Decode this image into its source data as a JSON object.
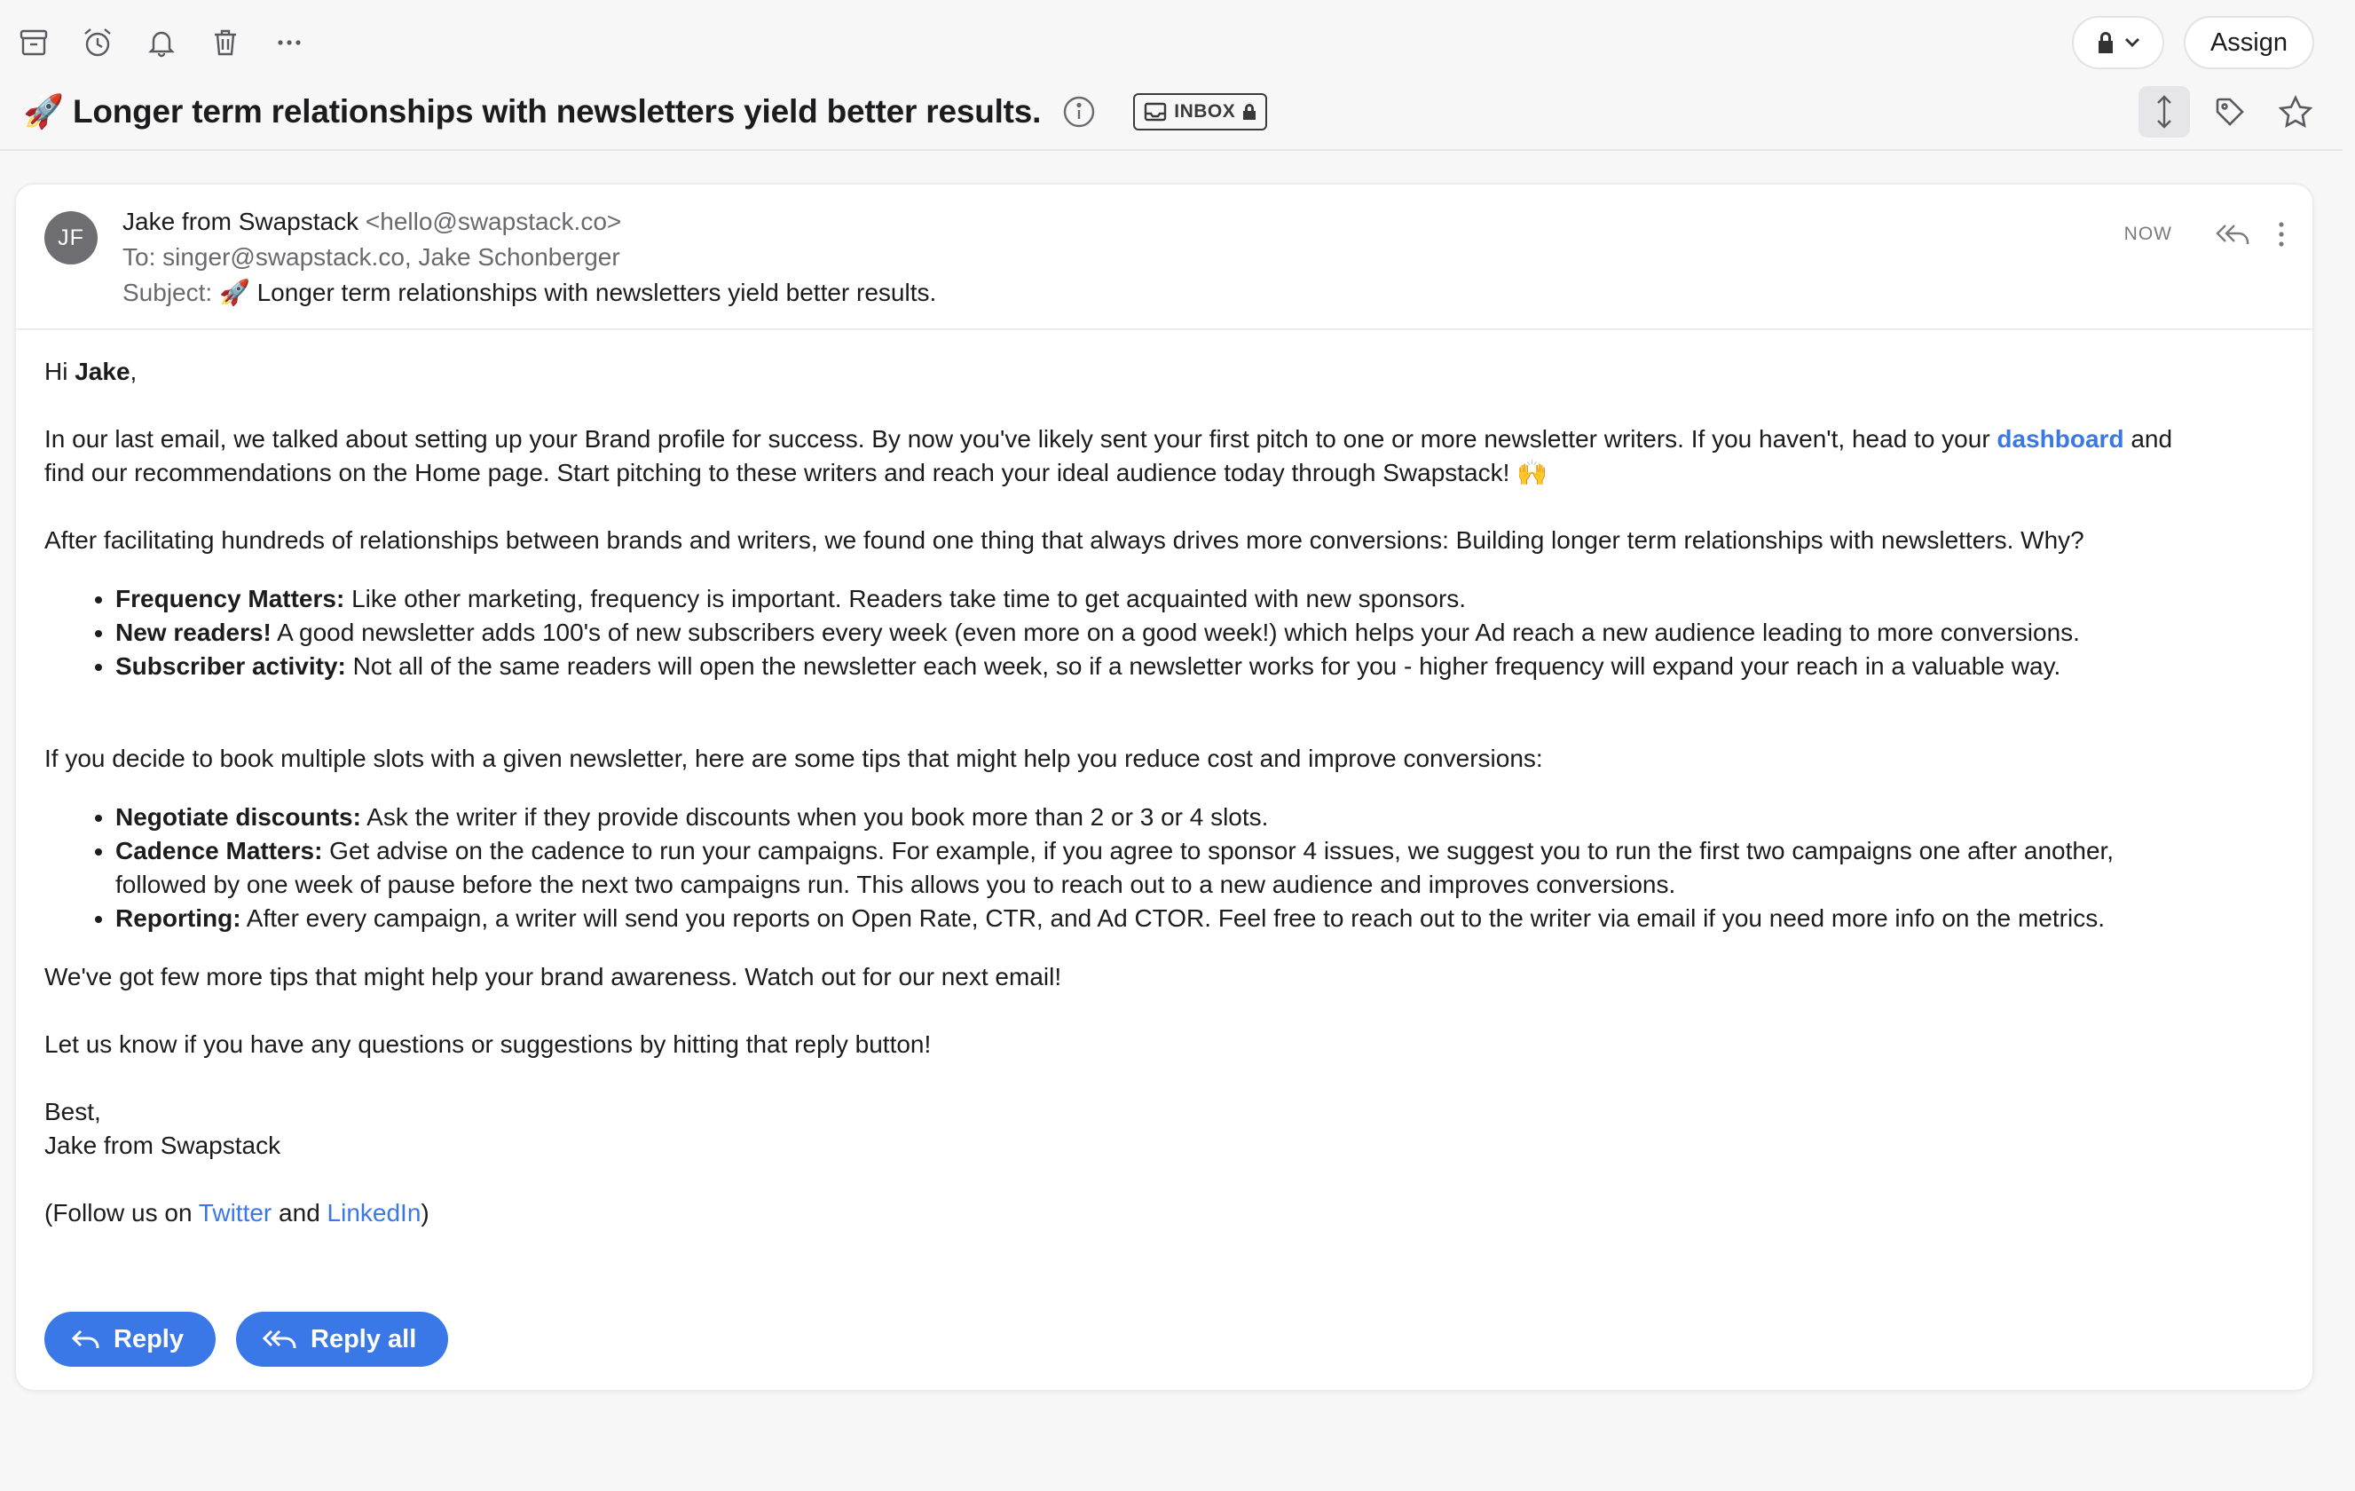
{
  "toolbar": {
    "icons": [
      "archive-icon",
      "snooze-icon",
      "bell-icon",
      "trash-icon",
      "more-icon"
    ],
    "assign_label": "Assign"
  },
  "email": {
    "title": "🚀 Longer term relationships with newsletters yield better results.",
    "inbox_badge": "INBOX",
    "avatar_initials": "JF",
    "from_name": "Jake from Swapstack",
    "from_address": "<hello@swapstack.co>",
    "to_line": "To: singer@swapstack.co, Jake Schonberger",
    "subject_prefix": "Subject:",
    "subject_text": "🚀 Longer term relationships with newsletters yield better results.",
    "time": "NOW"
  },
  "body": {
    "greeting_hi": "Hi ",
    "greeting_name": "Jake",
    "greeting_comma": ",",
    "p1_a": "In our last email, we talked about setting up your Brand profile for success. By now you've likely sent your first pitch to one or more newsletter writers. If you haven't, head to your ",
    "p1_link": "dashboard",
    "p1_b": " and",
    "p1_c": "find our recommendations on the Home page. Start pitching to these writers and reach your ideal audience today through Swapstack! 🙌",
    "p2": "After facilitating hundreds of relationships between brands and writers, we found one thing that always drives more conversions: Building longer term relationships with newsletters. Why?",
    "list1": [
      {
        "title": "Frequency Matters:",
        "text": " Like other marketing, frequency is important. Readers take time to get acquainted with new sponsors."
      },
      {
        "title": "New readers!",
        "text": " A good newsletter adds 100's of new subscribers every week (even more on a good week!) which helps your Ad reach a new audience leading to more conversions."
      },
      {
        "title": "Subscriber activity:",
        "text": " Not all of the same readers will open the newsletter each week, so if a newsletter works for you - higher frequency will expand your reach in a valuable way."
      }
    ],
    "p3": "If you decide to book multiple slots with a given newsletter, here are some tips that might help you reduce cost and improve conversions:",
    "list2": [
      {
        "title": "Negotiate discounts:",
        "text": " Ask the writer if they provide discounts when you book more than 2 or 3 or 4 slots."
      },
      {
        "title": "Cadence Matters:",
        "text": " Get advise on the cadence to run your campaigns. For example, if you agree to sponsor 4 issues, we suggest you to run the first two campaigns one after another, followed by one week of pause before the next two campaigns run. This allows you to reach out to a new audience and improves conversions."
      },
      {
        "title": "Reporting:",
        "text": " After every campaign, a writer will send you reports on Open Rate, CTR, and Ad CTOR. Feel free to reach out to the writer via email if you need more info on the metrics."
      }
    ],
    "p4": "We've got few more tips that might help your brand awareness. Watch out for our next email!",
    "p5": "Let us know if you have any questions or suggestions by hitting that reply button!",
    "signoff": "Best,",
    "signature": "Jake from Swapstack",
    "follow_a": "(Follow us on ",
    "follow_twitter": "Twitter",
    "follow_and": " and ",
    "follow_linkedin": "LinkedIn",
    "follow_b": ")"
  },
  "actions": {
    "reply_label": "Reply",
    "reply_all_label": "Reply all"
  },
  "colors": {
    "accent": "#3b78e7",
    "background": "#f7f7f8"
  }
}
